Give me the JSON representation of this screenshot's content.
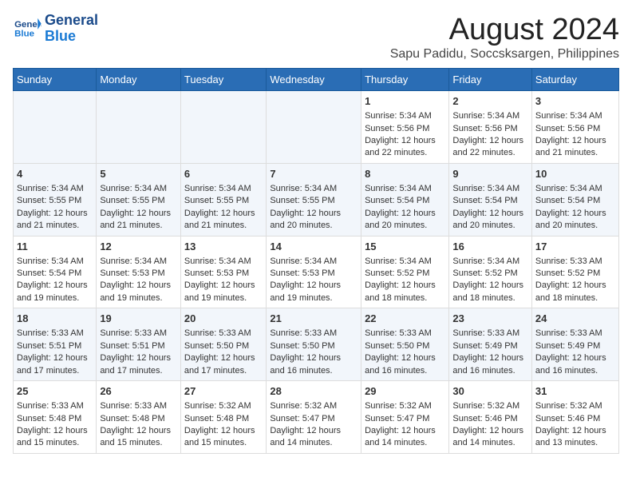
{
  "header": {
    "logo_line1": "General",
    "logo_line2": "Blue",
    "month_year": "August 2024",
    "location": "Sapu Padidu, Soccsksargen, Philippines"
  },
  "weekdays": [
    "Sunday",
    "Monday",
    "Tuesday",
    "Wednesday",
    "Thursday",
    "Friday",
    "Saturday"
  ],
  "weeks": [
    [
      {
        "day": "",
        "empty": true
      },
      {
        "day": "",
        "empty": true
      },
      {
        "day": "",
        "empty": true
      },
      {
        "day": "",
        "empty": true
      },
      {
        "day": "1",
        "sunrise": "5:34 AM",
        "sunset": "5:56 PM",
        "daylight": "12 hours and 22 minutes."
      },
      {
        "day": "2",
        "sunrise": "5:34 AM",
        "sunset": "5:56 PM",
        "daylight": "12 hours and 22 minutes."
      },
      {
        "day": "3",
        "sunrise": "5:34 AM",
        "sunset": "5:56 PM",
        "daylight": "12 hours and 21 minutes."
      }
    ],
    [
      {
        "day": "4",
        "sunrise": "5:34 AM",
        "sunset": "5:55 PM",
        "daylight": "12 hours and 21 minutes."
      },
      {
        "day": "5",
        "sunrise": "5:34 AM",
        "sunset": "5:55 PM",
        "daylight": "12 hours and 21 minutes."
      },
      {
        "day": "6",
        "sunrise": "5:34 AM",
        "sunset": "5:55 PM",
        "daylight": "12 hours and 21 minutes."
      },
      {
        "day": "7",
        "sunrise": "5:34 AM",
        "sunset": "5:55 PM",
        "daylight": "12 hours and 20 minutes."
      },
      {
        "day": "8",
        "sunrise": "5:34 AM",
        "sunset": "5:54 PM",
        "daylight": "12 hours and 20 minutes."
      },
      {
        "day": "9",
        "sunrise": "5:34 AM",
        "sunset": "5:54 PM",
        "daylight": "12 hours and 20 minutes."
      },
      {
        "day": "10",
        "sunrise": "5:34 AM",
        "sunset": "5:54 PM",
        "daylight": "12 hours and 20 minutes."
      }
    ],
    [
      {
        "day": "11",
        "sunrise": "5:34 AM",
        "sunset": "5:54 PM",
        "daylight": "12 hours and 19 minutes."
      },
      {
        "day": "12",
        "sunrise": "5:34 AM",
        "sunset": "5:53 PM",
        "daylight": "12 hours and 19 minutes."
      },
      {
        "day": "13",
        "sunrise": "5:34 AM",
        "sunset": "5:53 PM",
        "daylight": "12 hours and 19 minutes."
      },
      {
        "day": "14",
        "sunrise": "5:34 AM",
        "sunset": "5:53 PM",
        "daylight": "12 hours and 19 minutes."
      },
      {
        "day": "15",
        "sunrise": "5:34 AM",
        "sunset": "5:52 PM",
        "daylight": "12 hours and 18 minutes."
      },
      {
        "day": "16",
        "sunrise": "5:34 AM",
        "sunset": "5:52 PM",
        "daylight": "12 hours and 18 minutes."
      },
      {
        "day": "17",
        "sunrise": "5:33 AM",
        "sunset": "5:52 PM",
        "daylight": "12 hours and 18 minutes."
      }
    ],
    [
      {
        "day": "18",
        "sunrise": "5:33 AM",
        "sunset": "5:51 PM",
        "daylight": "12 hours and 17 minutes."
      },
      {
        "day": "19",
        "sunrise": "5:33 AM",
        "sunset": "5:51 PM",
        "daylight": "12 hours and 17 minutes."
      },
      {
        "day": "20",
        "sunrise": "5:33 AM",
        "sunset": "5:50 PM",
        "daylight": "12 hours and 17 minutes."
      },
      {
        "day": "21",
        "sunrise": "5:33 AM",
        "sunset": "5:50 PM",
        "daylight": "12 hours and 16 minutes."
      },
      {
        "day": "22",
        "sunrise": "5:33 AM",
        "sunset": "5:50 PM",
        "daylight": "12 hours and 16 minutes."
      },
      {
        "day": "23",
        "sunrise": "5:33 AM",
        "sunset": "5:49 PM",
        "daylight": "12 hours and 16 minutes."
      },
      {
        "day": "24",
        "sunrise": "5:33 AM",
        "sunset": "5:49 PM",
        "daylight": "12 hours and 16 minutes."
      }
    ],
    [
      {
        "day": "25",
        "sunrise": "5:33 AM",
        "sunset": "5:48 PM",
        "daylight": "12 hours and 15 minutes."
      },
      {
        "day": "26",
        "sunrise": "5:33 AM",
        "sunset": "5:48 PM",
        "daylight": "12 hours and 15 minutes."
      },
      {
        "day": "27",
        "sunrise": "5:32 AM",
        "sunset": "5:48 PM",
        "daylight": "12 hours and 15 minutes."
      },
      {
        "day": "28",
        "sunrise": "5:32 AM",
        "sunset": "5:47 PM",
        "daylight": "12 hours and 14 minutes."
      },
      {
        "day": "29",
        "sunrise": "5:32 AM",
        "sunset": "5:47 PM",
        "daylight": "12 hours and 14 minutes."
      },
      {
        "day": "30",
        "sunrise": "5:32 AM",
        "sunset": "5:46 PM",
        "daylight": "12 hours and 14 minutes."
      },
      {
        "day": "31",
        "sunrise": "5:32 AM",
        "sunset": "5:46 PM",
        "daylight": "12 hours and 13 minutes."
      }
    ]
  ]
}
